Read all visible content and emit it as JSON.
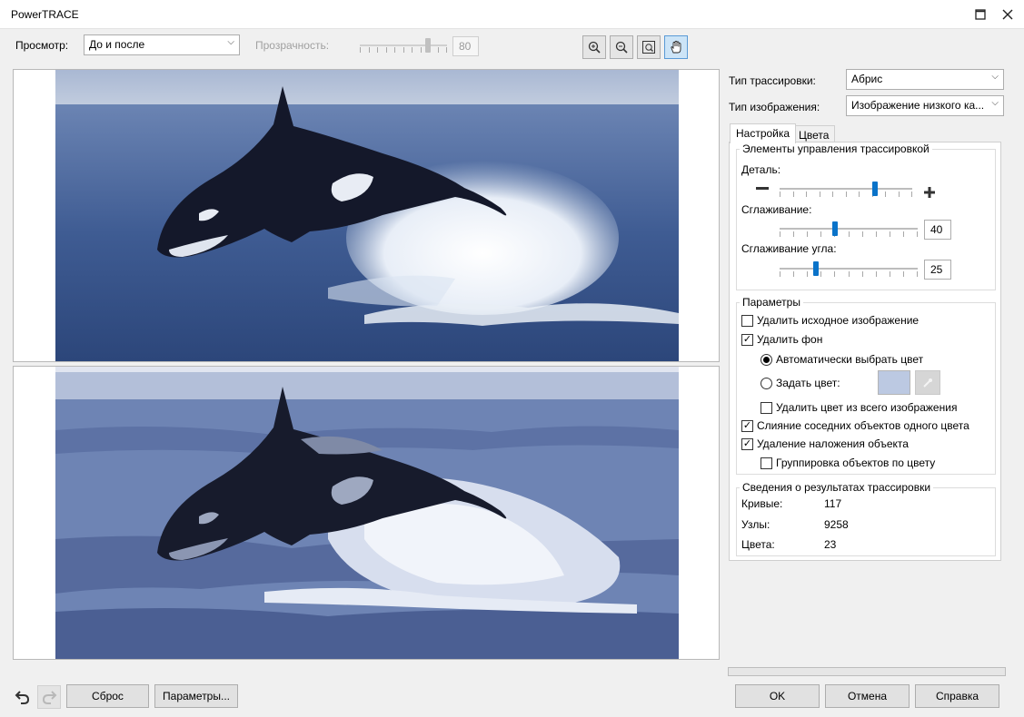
{
  "window": {
    "title": "PowerTRACE"
  },
  "toolbar": {
    "view_label": "Просмотр:",
    "view_value": "До и после",
    "transparency_label": "Прозрачность:",
    "transparency_value": "80"
  },
  "right": {
    "trace_type_label": "Тип трассировки:",
    "trace_type_value": "Абрис",
    "image_type_label": "Тип изображения:",
    "image_type_value": "Изображение низкого ка...",
    "tabs": [
      "Настройка",
      "Цвета"
    ],
    "controls_group": "Элементы управления трассировкой",
    "detail_label": "Деталь:",
    "smoothing_label": "Сглаживание:",
    "smoothing_value": "40",
    "corner_label": "Сглаживание угла:",
    "corner_value": "25",
    "params_group": "Параметры",
    "opt_delete_original": "Удалить исходное изображение",
    "opt_delete_bg": "Удалить фон",
    "opt_auto_color": "Автоматически выбрать цвет",
    "opt_set_color": "Задать цвет:",
    "opt_remove_color_all": "Удалить цвет из всего изображения",
    "opt_merge": "Слияние соседних объектов одного цвета",
    "opt_remove_overlap": "Удаление наложения объекта",
    "opt_group_by_color": "Группировка объектов по цвету",
    "results_group": "Сведения о результатах трассировки",
    "curves_label": "Кривые:",
    "curves_value": "117",
    "nodes_label": "Узлы:",
    "nodes_value": "9258",
    "colors_label": "Цвета:",
    "colors_value": "23"
  },
  "bottom": {
    "reset": "Сброс",
    "options": "Параметры...",
    "ok": "OK",
    "cancel": "Отмена",
    "help": "Справка"
  },
  "colors": {
    "accent": "#0a73c9",
    "bg_swatch": "#bcc9e2"
  },
  "state": {
    "detail_level": 0.73,
    "smoothing_level": 0.4,
    "corner_level": 0.25,
    "transparency_level": 0.8,
    "delete_original": false,
    "delete_bg": true,
    "auto_color": true,
    "remove_color_all": false,
    "merge_adjacent": true,
    "remove_overlap": true,
    "group_by_color": false
  }
}
